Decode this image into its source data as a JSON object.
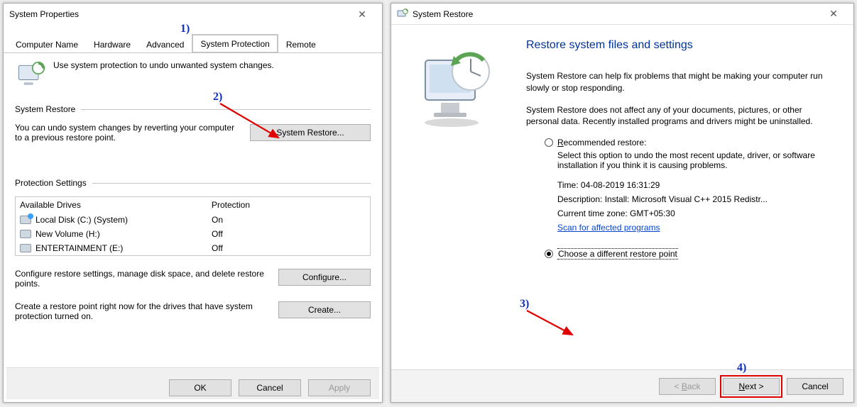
{
  "left": {
    "title": "System Properties",
    "tabs": {
      "computer_name": "Computer Name",
      "hardware": "Hardware",
      "advanced": "Advanced",
      "system_protection": "System Protection",
      "remote": "Remote"
    },
    "intro": "Use system protection to undo unwanted system changes.",
    "sr_legend": "System Restore",
    "sr_text": "You can undo system changes by reverting your computer to a previous restore point.",
    "sr_button": "System Restore...",
    "ps_legend": "Protection Settings",
    "drives_hdr_drive": "Available Drives",
    "drives_hdr_prot": "Protection",
    "drives": [
      {
        "name": "Local Disk (C:) (System)",
        "prot": "On",
        "sys": true
      },
      {
        "name": "New Volume (H:)",
        "prot": "Off",
        "sys": false
      },
      {
        "name": "ENTERTAINMENT (E:)",
        "prot": "Off",
        "sys": false
      }
    ],
    "configure_text": "Configure restore settings, manage disk space, and delete restore points.",
    "configure_btn": "Configure...",
    "create_text": "Create a restore point right now for the drives that have system protection turned on.",
    "create_btn": "Create...",
    "ok": "OK",
    "cancel": "Cancel",
    "apply": "Apply"
  },
  "right": {
    "title": "System Restore",
    "heading": "Restore system files and settings",
    "p1": "System Restore can help fix problems that might be making your computer run slowly or stop responding.",
    "p2": "System Restore does not affect any of your documents, pictures, or other personal data. Recently installed programs and drivers might be uninstalled.",
    "opt_recommended_prefix": "R",
    "opt_recommended_rest": "ecommended restore:",
    "opt_recommended_desc": "Select this option to undo the most recent update, driver, or software installation if you think it is causing problems.",
    "detail_time": "Time: 04-08-2019 16:31:29",
    "detail_desc": "Description: Install: Microsoft Visual C++ 2015 Redistr...",
    "detail_tz": "Current time zone: GMT+05:30",
    "scan_link": "Scan for affected programs",
    "opt_choose": "Choose a different restore point",
    "btn_back_prefix": "< ",
    "btn_back_u": "B",
    "btn_back_rest": "ack",
    "btn_next_u": "N",
    "btn_next_rest": "ext >",
    "btn_cancel": "Cancel"
  },
  "annotations": {
    "n1": "1)",
    "n2": "2)",
    "n3": "3)",
    "n4": "4)"
  }
}
